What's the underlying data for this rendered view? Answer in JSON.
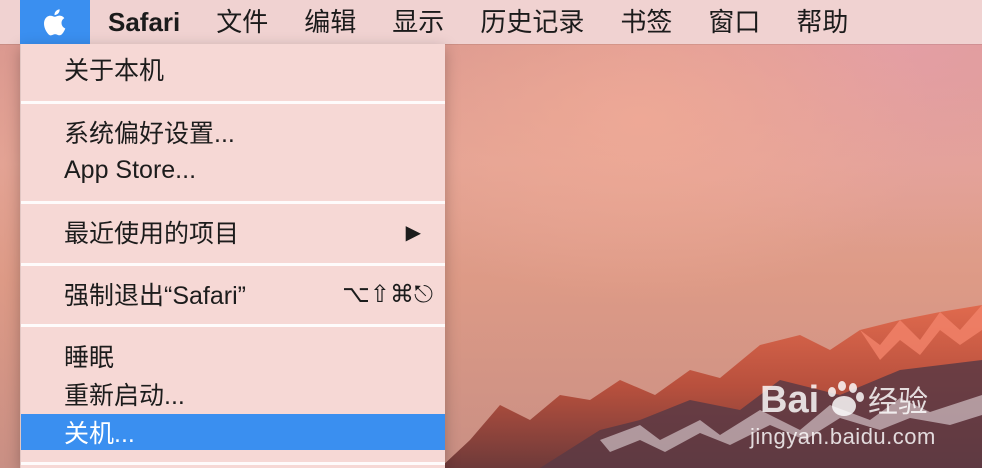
{
  "menubar": {
    "apple_icon": "apple-logo-icon",
    "items": [
      "Safari",
      "文件",
      "编辑",
      "显示",
      "历史记录",
      "书签",
      "窗口",
      "帮助"
    ]
  },
  "apple_menu": {
    "about": "关于本机",
    "system_prefs": "系统偏好设置...",
    "app_store": "App Store...",
    "recent_items": "最近使用的项目",
    "recent_items_arrow": "▶",
    "force_quit": "强制退出“Safari”",
    "force_quit_shortcut": "⌥⇧⌘⎋",
    "sleep": "睡眠",
    "restart": "重新启动...",
    "shutdown": "关机..."
  },
  "watermark": {
    "logo_text": "Bai 经验",
    "url": "jingyan.baidu.com"
  },
  "colors": {
    "selection": "#3a8ff0",
    "menubar": "#f0d2d1",
    "menu_bg": "#f6d8d5"
  }
}
